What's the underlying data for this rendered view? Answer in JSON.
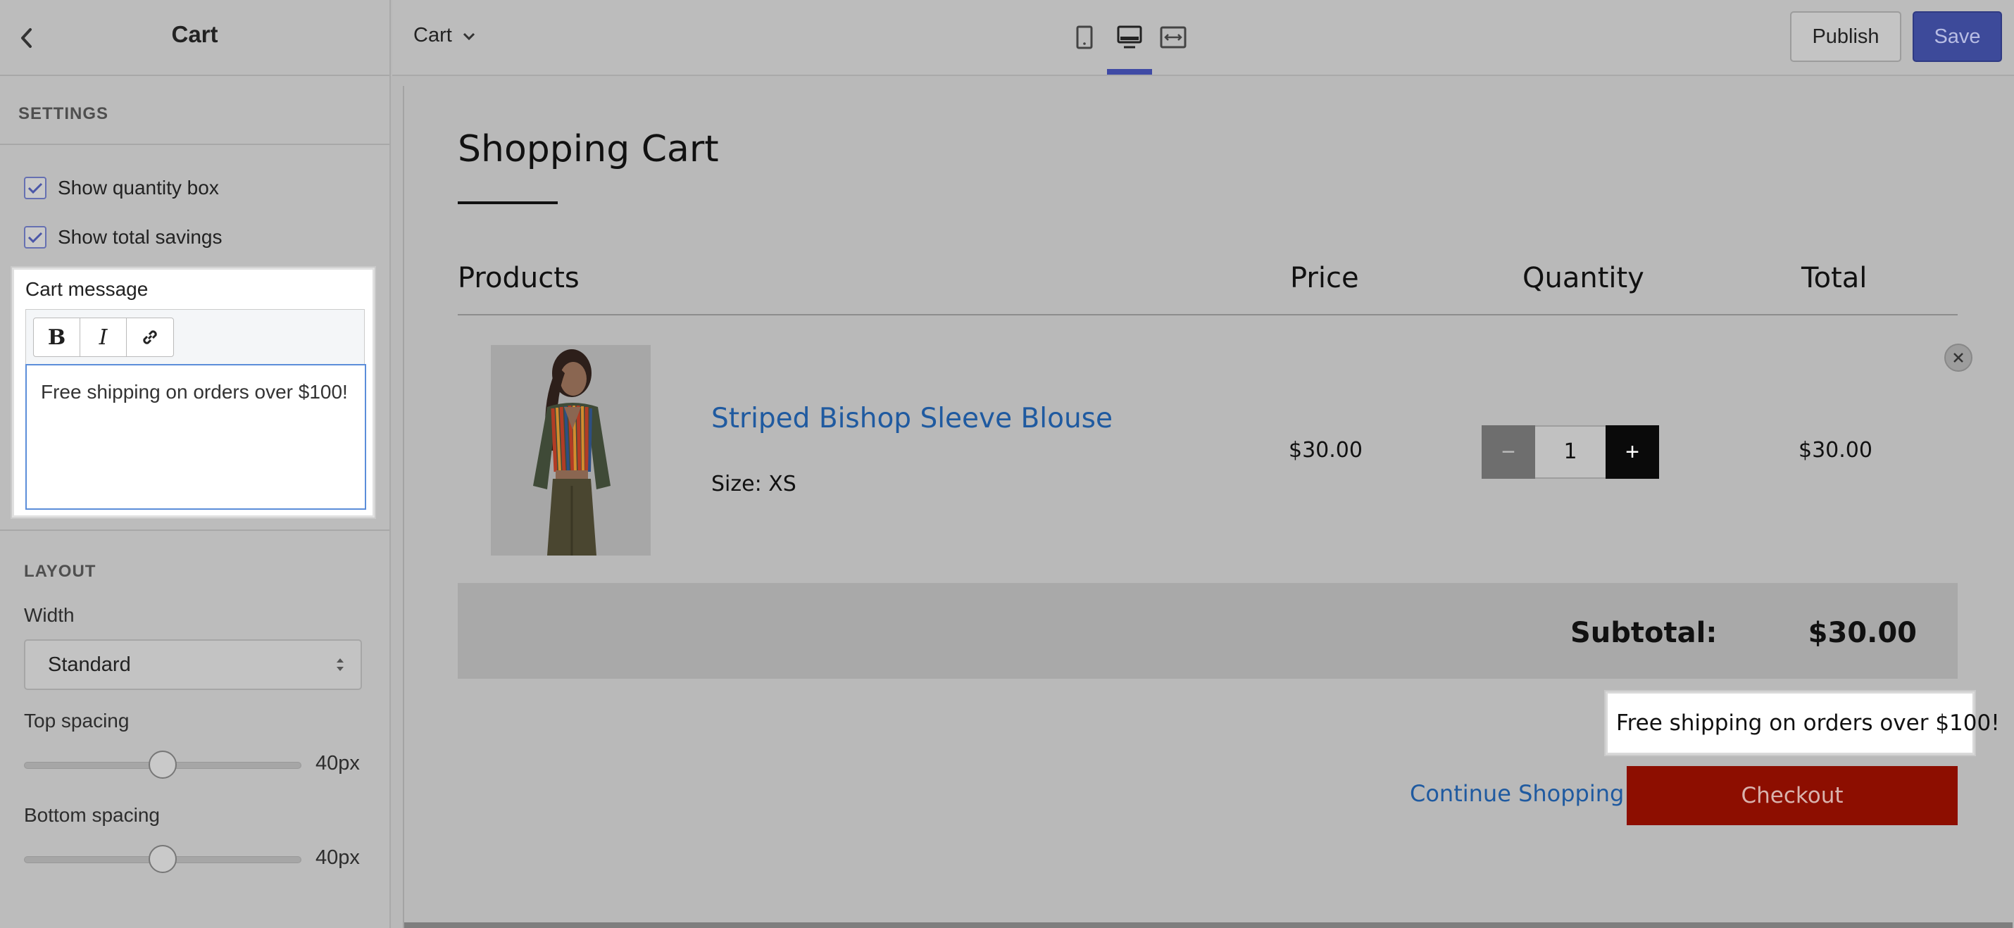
{
  "sidebar": {
    "title": "Cart",
    "back_icon": "chevron-left-icon",
    "settings_heading": "SETTINGS",
    "show_quantity_label": "Show quantity box",
    "show_quantity_checked": true,
    "show_savings_label": "Show total savings",
    "show_savings_checked": true,
    "cart_message_label": "Cart message",
    "toolbar": {
      "bold": "B",
      "italic": "I",
      "link_icon": "link-icon"
    },
    "cart_message_value": "Free shipping on orders over $100!",
    "layout_heading": "LAYOUT",
    "width_label": "Width",
    "width_value": "Standard",
    "top_spacing_label": "Top spacing",
    "top_spacing_value": "40px",
    "bottom_spacing_label": "Bottom spacing",
    "bottom_spacing_value": "40px"
  },
  "topbar": {
    "page_select": "Cart",
    "devices": [
      "mobile-icon",
      "desktop-icon",
      "fullwidth-icon"
    ],
    "active_device": "desktop",
    "publish_label": "Publish",
    "save_label": "Save",
    "accent_color": "#3d4a9a"
  },
  "preview": {
    "title": "Shopping Cart",
    "columns": {
      "products": "Products",
      "price": "Price",
      "quantity": "Quantity",
      "total": "Total"
    },
    "item": {
      "name": "Striped Bishop Sleeve Blouse",
      "size": "Size: XS",
      "price": "$30.00",
      "quantity": "1",
      "total": "$30.00",
      "minus": "−",
      "plus": "+"
    },
    "subtotal_label": "Subtotal:",
    "subtotal_value": "$30.00",
    "cart_note": "Free shipping on orders over $100!",
    "continue_label": "Continue Shopping",
    "checkout_label": "Checkout",
    "checkout_color": "#8d0e00",
    "link_color": "#1f5aa0"
  }
}
